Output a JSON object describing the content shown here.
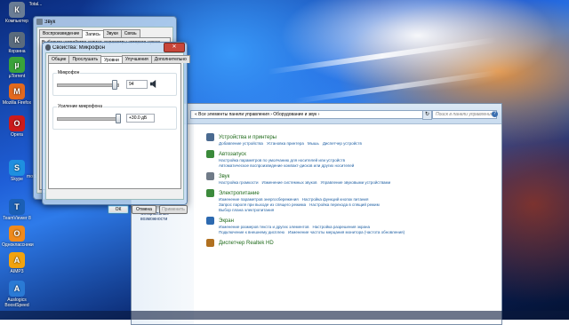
{
  "desktop": {
    "icons": [
      {
        "label": "Компьютер",
        "icon": "computer-icon",
        "color": "#6a7d95"
      },
      {
        "label": "Корзина",
        "icon": "recycle-bin-icon",
        "color": "#5a6b7d"
      },
      {
        "label": "µTorrent",
        "icon": "utorrent-icon",
        "color": "#3aa33a"
      },
      {
        "label": "Mozilla Firefox",
        "icon": "firefox-icon",
        "color": "#e3691e"
      },
      {
        "label": "Opera",
        "icon": "opera-icon",
        "color": "#cc1b1b"
      },
      {
        "label": "Skype",
        "icon": "skype-icon",
        "color": "#1e8fe0"
      },
      {
        "label": "TeamViewer 8",
        "icon": "teamviewer-icon",
        "color": "#1b5fb5"
      },
      {
        "label": "Одноклассники",
        "icon": "odnoklassniki-icon",
        "color": "#f08a1c"
      },
      {
        "label": "AIMP3",
        "icon": "aimp-icon",
        "color": "#f2a30f"
      },
      {
        "label": "Auslogics BoostSpeed",
        "icon": "boostspeed-icon",
        "color": "#2a7ad5"
      }
    ],
    "partial_icon_label": "Total...",
    "partial_icon_label2": "mod..."
  },
  "sound_window": {
    "title": "Звук",
    "tabs": [
      "Воспроизведение",
      "Запись",
      "Звуки",
      "Связь"
    ],
    "selected_tab": 1,
    "instruction": "Выберите устройство записи, параметры которого нужно"
  },
  "mic_dialog": {
    "title": "Свойства: Микрофон",
    "tabs": [
      "Общие",
      "Прослушать",
      "Уровни",
      "Улучшения",
      "Дополнительно"
    ],
    "selected_tab": 2,
    "mic_group_label": "Микрофон",
    "mic_value": "94",
    "mic_level": 0.94,
    "boost_group_label": "Усиление микрофона",
    "boost_value": "+30.0 дБ",
    "boost_level": 1.0,
    "buttons": {
      "ok": "ОК",
      "cancel": "Отмена",
      "apply": "Применить"
    }
  },
  "control_panel": {
    "breadcrumb": "« Все элементы панели управления › Оборудование и звук ›",
    "search_placeholder": "Поиск в панели управления",
    "sidebar_link": "Специальные возможности",
    "categories": [
      {
        "title": "Устройства и принтеры",
        "icon": "printer-icon",
        "color": "#4a6a90",
        "links": [
          "Добавление устройства",
          "Установка принтера",
          "Мышь",
          "Диспетчер устройств"
        ]
      },
      {
        "title": "Автозапуск",
        "icon": "autoplay-icon",
        "color": "#3a8a3a",
        "links": [
          "Настройка параметров по умолчанию для носителей или устройств",
          "Автоматическое воспроизведение компакт-дисков или других носителей"
        ]
      },
      {
        "title": "Звук",
        "icon": "speaker-icon",
        "color": "#707b88",
        "links": [
          "Настройка громкости",
          "Изменение системных звуков",
          "Управление звуковыми устройствами"
        ]
      },
      {
        "title": "Электропитание",
        "icon": "power-icon",
        "color": "#3c8a3c",
        "links": [
          "Изменение параметров энергосбережения",
          "Настройка функций кнопок питания",
          "Запрос пароля при выходе из спящего режима",
          "Настройка перехода в спящий режим",
          "Выбор плана электропитания"
        ]
      },
      {
        "title": "Экран",
        "icon": "display-icon",
        "color": "#2d6ab0",
        "links": [
          "Изменение размеров текста и других элементов",
          "Настройка разрешения экрана",
          "Подключение к внешнему дисплею",
          "Изменение частоты мерцания монитора (частота обновления)"
        ]
      },
      {
        "title": "Диспетчер Realtek HD",
        "icon": "realtek-icon",
        "color": "#b07020",
        "links": []
      }
    ]
  }
}
